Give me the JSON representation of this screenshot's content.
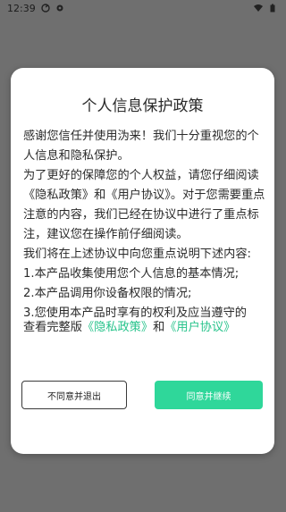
{
  "status_bar": {
    "time": "12:39"
  },
  "dialog": {
    "title": "个人信息保护政策",
    "paragraphs": [
      "感谢您信任并使用沩来！我们十分重视您的个人信息和隐私保护。",
      "为了更好的保障您的个人权益，请您仔细阅读《隐私政策》和《用户协议》。对于您需要重点注意的内容，我们已经在协议中进行了重点标注，建议您在操作前仔细阅读。",
      "我们将在上述协议中向您重点说明下述内容:",
      "1.本产品收集使用您个人信息的基本情况;",
      "2.本产品调用你设备权限的情况;",
      "3.您使用本产品时享有的权利及应当遵守的"
    ],
    "footer_prefix": "查看完整版",
    "privacy_link": "《隐私政策》",
    "and_text": "和",
    "user_agreement_link": "《用户协议》",
    "decline_label": "不同意并退出",
    "accept_label": "同意并继续"
  },
  "colors": {
    "accent": "#2fd79a",
    "link": "#27c38b",
    "overlay": "#6f6f6f"
  }
}
